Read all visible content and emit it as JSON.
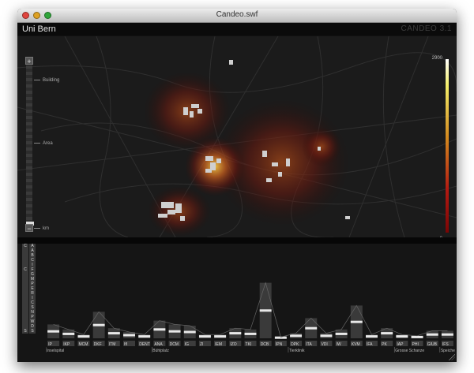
{
  "window": {
    "title": "Candeo.swf"
  },
  "app": {
    "name": "Uni Bern",
    "brand": "CANDEO 3.1"
  },
  "map": {
    "zoom": {
      "in_label": "+",
      "out_label": "−",
      "labels": [
        "Building",
        "Area",
        "km"
      ]
    },
    "legend": {
      "max_label": "2900",
      "min_label": "0"
    }
  },
  "filter": {
    "col1": [
      "C",
      "",
      "",
      "",
      "",
      "C",
      "",
      "",
      "",
      "",
      "",
      "",
      "",
      "",
      "",
      "",
      "",
      "",
      "S"
    ],
    "col2": [
      "A",
      "A",
      "B",
      "C",
      "I",
      "F",
      "G",
      "M",
      "P",
      "E",
      "R",
      "I",
      "C",
      "S",
      "N",
      "P",
      "W",
      "D",
      "S"
    ]
  },
  "chart_data": {
    "type": "bar",
    "categories": [
      "IP",
      "IKP",
      "MCM",
      "DKF",
      "ITM",
      "IfI",
      "DENT",
      "ANA",
      "DCM",
      "IG",
      "ZI",
      "IEM",
      "IZO",
      "TKI",
      "DCB",
      "IPN",
      "DPK",
      "ITA",
      "VDI",
      "IW",
      "KVM",
      "IFA",
      "PK",
      "IAP",
      "PHI",
      "GIUB",
      "IFS"
    ],
    "series": [
      {
        "name": "",
        "values": [
          22,
          14,
          6,
          42,
          16,
          10,
          6,
          28,
          22,
          20,
          6,
          6,
          16,
          14,
          88,
          2,
          8,
          32,
          8,
          14,
          52,
          6,
          16,
          6,
          4,
          12,
          12
        ]
      }
    ],
    "group_labels": [
      "Inselspital",
      "Bühlplatz",
      "Tierklinik",
      "Grosse Schanze",
      "Speiche"
    ]
  }
}
